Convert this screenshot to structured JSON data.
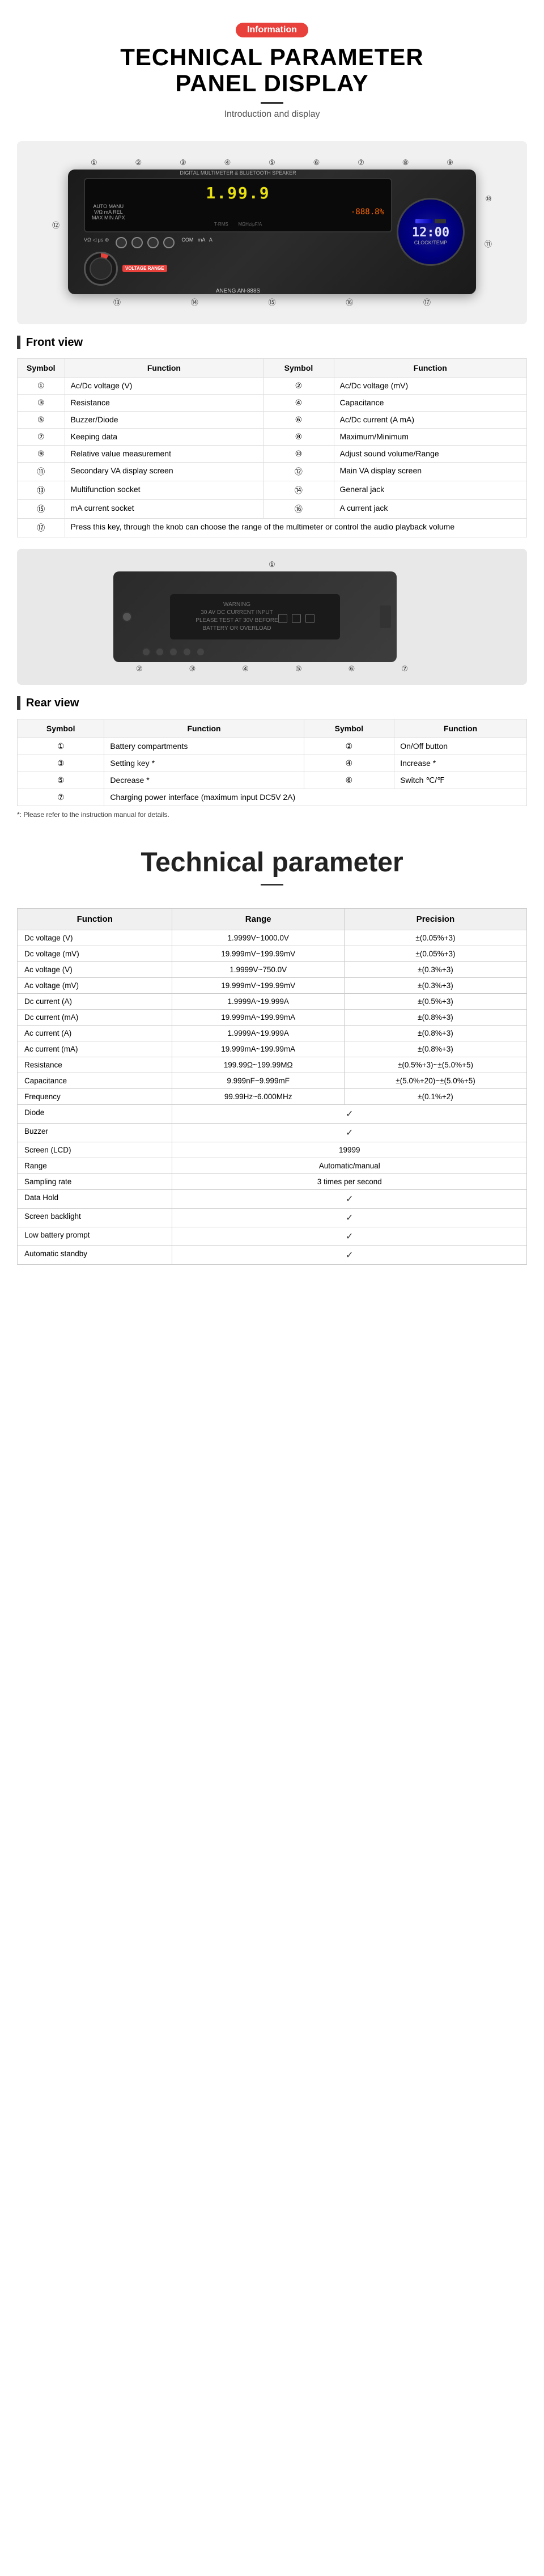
{
  "header": {
    "badge": "Information",
    "title_line1": "TECHNICAL PARAMETER",
    "title_line2": "PANEL DISPLAY",
    "subtitle": "Introduction and display"
  },
  "front_view": {
    "section_title": "Front view",
    "table_headers": [
      "Symbol",
      "Function",
      "Symbol",
      "Function"
    ],
    "rows": [
      {
        "sym1": "①",
        "func1": "Ac/Dc voltage (V)",
        "sym2": "②",
        "func2": "Ac/Dc voltage (mV)"
      },
      {
        "sym1": "③",
        "func1": "Resistance",
        "sym2": "④",
        "func2": "Capacitance"
      },
      {
        "sym1": "⑤",
        "func1": "Buzzer/Diode",
        "sym2": "⑥",
        "func2": "Ac/Dc current (A mA)"
      },
      {
        "sym1": "⑦",
        "func1": "Keeping data",
        "sym2": "⑧",
        "func2": "Maximum/Minimum"
      },
      {
        "sym1": "⑨",
        "func1": "Relative value measurement",
        "sym2": "⑩",
        "func2": "Adjust sound volume/Range"
      },
      {
        "sym1": "⑪",
        "func1": "Secondary VA display screen",
        "sym2": "⑫",
        "func2": "Main VA display screen"
      },
      {
        "sym1": "⑬",
        "func1": "Multifunction socket",
        "sym2": "⑭",
        "func2": "General jack"
      },
      {
        "sym1": "⑮",
        "func1": "mA current socket",
        "sym2": "⑯",
        "func2": "A current jack"
      }
    ],
    "note_row": {
      "sym1": "⑰",
      "func1": "Press this key, through the knob can choose the range of the multimeter or control the audio playback volume"
    },
    "device_display_value": "1.99.9",
    "device_display_sub": "-888.8%",
    "device_brand": "ANENG AN-888S",
    "clock_value": "12:00",
    "clock_label": "CLOCK/TEMP"
  },
  "rear_view": {
    "section_title": "Rear view",
    "table_headers": [
      "Symbol",
      "Function",
      "Symbol",
      "Function"
    ],
    "rows": [
      {
        "sym1": "①",
        "func1": "Battery compartments",
        "sym2": "②",
        "func2": "On/Off button"
      },
      {
        "sym1": "③",
        "func1": "Setting key *",
        "sym2": "④",
        "func2": "Increase *"
      },
      {
        "sym1": "⑤",
        "func1": "Decrease *",
        "sym2": "⑥",
        "func2": "Switch ℃/℉"
      },
      {
        "sym1": "⑦",
        "func1": "Charging power interface (maximum input DC5V 2A)"
      }
    ],
    "note": "*: Please refer to the instruction manual for details.",
    "warning_text": "WARNING\n30 AV DC CURRENT INPUT\nPLEASE TEST AT 30V BEFORE\nBATTERY OR OVERLOAD"
  },
  "tech_param": {
    "title": "Technical parameter",
    "table_headers": [
      "Function",
      "Range",
      "Precision"
    ],
    "rows": [
      {
        "func": "Dc voltage (V)",
        "range": "1.9999V~1000.0V",
        "precision": "±(0.05%+3)"
      },
      {
        "func": "Dc voltage (mV)",
        "range": "19.999mV~199.99mV",
        "precision": "±(0.05%+3)"
      },
      {
        "func": "Ac voltage (V)",
        "range": "1.9999V~750.0V",
        "precision": "±(0.3%+3)"
      },
      {
        "func": "Ac voltage (mV)",
        "range": "19.999mV~199.99mV",
        "precision": "±(0.3%+3)"
      },
      {
        "func": "Dc current (A)",
        "range": "1.9999A~19.999A",
        "precision": "±(0.5%+3)"
      },
      {
        "func": "Dc current (mA)",
        "range": "19.999mA~199.99mA",
        "precision": "±(0.8%+3)"
      },
      {
        "func": "Ac current (A)",
        "range": "1.9999A~19.999A",
        "precision": "±(0.8%+3)"
      },
      {
        "func": "Ac current (mA)",
        "range": "19.999mA~199.99mA",
        "precision": "±(0.8%+3)"
      },
      {
        "func": "Resistance",
        "range": "199.99Ω~199.99MΩ",
        "precision": "±(0.5%+3)~±(5.0%+5)"
      },
      {
        "func": "Capacitance",
        "range": "9.999nF~9.999mF",
        "precision": "±(5.0%+20)~±(5.0%+5)"
      },
      {
        "func": "Frequency",
        "range": "99.99Hz~6.000MHz",
        "precision": "±(0.1%+2)"
      },
      {
        "func": "Diode",
        "range": "",
        "precision": "check"
      },
      {
        "func": "Buzzer",
        "range": "",
        "precision": "check"
      },
      {
        "func": "Screen (LCD)",
        "range": "19999",
        "precision": ""
      },
      {
        "func": "Range",
        "range": "Automatic/manual",
        "precision": ""
      },
      {
        "func": "Sampling rate",
        "range": "3 times per second",
        "precision": ""
      },
      {
        "func": "Data Hold",
        "range": "",
        "precision": "check"
      },
      {
        "func": "Screen backlight",
        "range": "",
        "precision": "check"
      },
      {
        "func": "Low battery prompt",
        "range": "",
        "precision": "check"
      },
      {
        "func": "Automatic standby",
        "range": "",
        "precision": "check"
      }
    ]
  },
  "device": {
    "front_numbers": [
      "1",
      "2",
      "3",
      "4",
      "5",
      "6",
      "7",
      "8",
      "9",
      "10",
      "11",
      "12",
      "13",
      "14",
      "15",
      "16",
      "17"
    ],
    "rear_numbers": [
      "1",
      "2",
      "3",
      "4",
      "5",
      "6",
      "7"
    ]
  }
}
